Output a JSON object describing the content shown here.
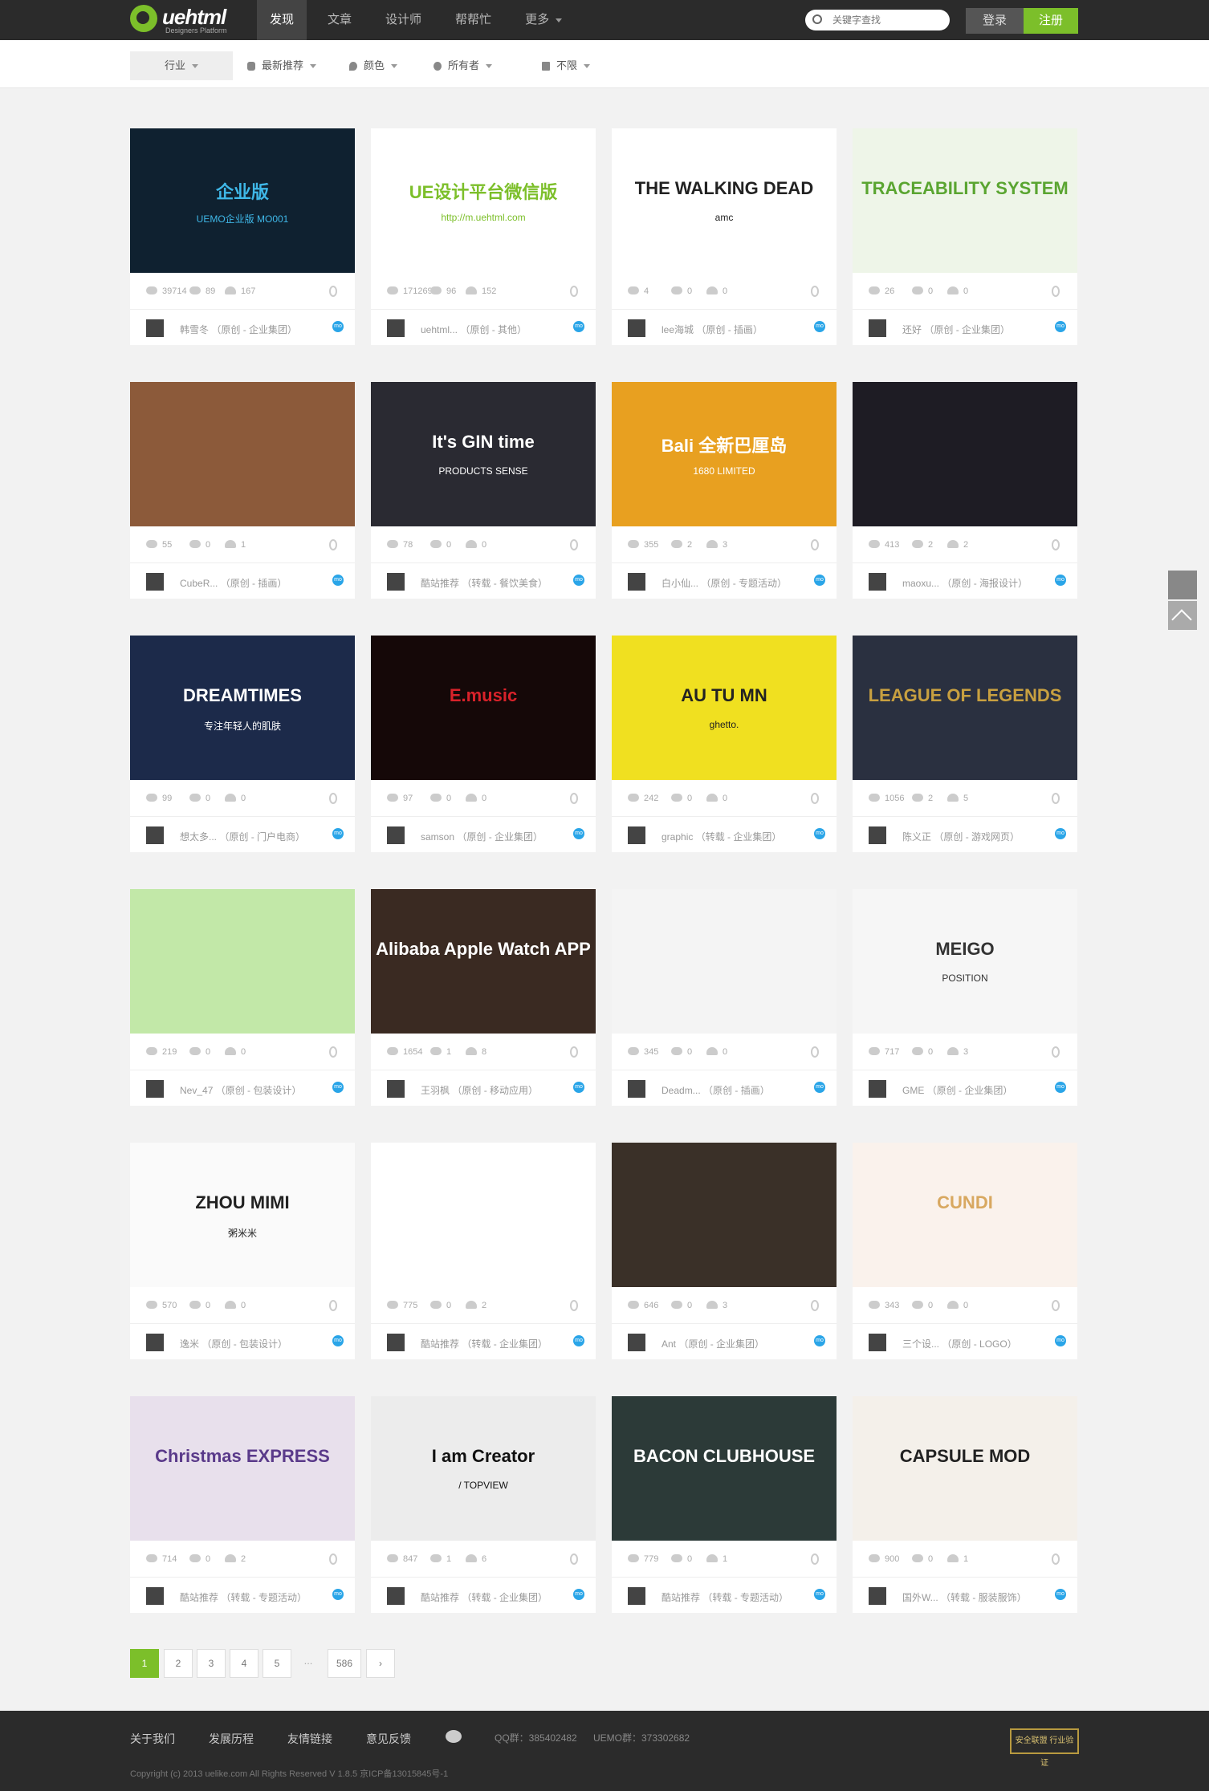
{
  "header": {
    "logo_text": "uehtml",
    "logo_sub": "Designers Platform",
    "nav": [
      "发现",
      "文章",
      "设计师",
      "帮帮忙",
      "更多"
    ],
    "search_placeholder": "关键字查找",
    "login": "登录",
    "register": "注册"
  },
  "filters": [
    "行业",
    "最新推荐",
    "颜色",
    "所有者",
    "不限"
  ],
  "cards": [
    {
      "title": "企业版",
      "sub": "UEMO企业版  MO001",
      "bg": "#0f2130",
      "fg": "#3fb8e8",
      "views": "39714",
      "comments": "89",
      "likes": "167",
      "author": "韩雪冬",
      "category": "（原创 - 企业集团）"
    },
    {
      "title": "UE设计平台微信版",
      "sub": "http://m.uehtml.com",
      "bg": "#ffffff",
      "fg": "#7cbf2a",
      "views": "171269",
      "comments": "96",
      "likes": "152",
      "author": "uehtml...",
      "category": "（原创 - 其他）"
    },
    {
      "title": "THE WALKING DEAD",
      "sub": "amc",
      "bg": "#ffffff",
      "fg": "#222222",
      "views": "4",
      "comments": "0",
      "likes": "0",
      "author": "lee海城",
      "category": "（原创 - 插画）"
    },
    {
      "title": "TRACEABILITY SYSTEM",
      "sub": "",
      "bg": "#eef5e8",
      "fg": "#5aa531",
      "views": "26",
      "comments": "0",
      "likes": "0",
      "author": "还好",
      "category": "（原创 - 企业集团）"
    },
    {
      "title": "",
      "sub": "",
      "bg": "#8c5a3a",
      "fg": "#ffffff",
      "views": "55",
      "comments": "0",
      "likes": "1",
      "author": "CubeR...",
      "category": "（原创 - 插画）"
    },
    {
      "title": "It's GIN time",
      "sub": "PRODUCTS  SENSE",
      "bg": "#2a2a32",
      "fg": "#ffffff",
      "views": "78",
      "comments": "0",
      "likes": "0",
      "author": "酷站推荐",
      "category": "（转载 - 餐饮美食）"
    },
    {
      "title": "Bali 全新巴厘岛",
      "sub": "1680 LIMITED",
      "bg": "#e8a020",
      "fg": "#ffffff",
      "views": "355",
      "comments": "2",
      "likes": "3",
      "author": "白小仙...",
      "category": "（原创 - 专题活动）"
    },
    {
      "title": "",
      "sub": "",
      "bg": "#1e1c24",
      "fg": "#ffffff",
      "views": "413",
      "comments": "2",
      "likes": "2",
      "author": "maoxu...",
      "category": "（原创 - 海报设计）"
    },
    {
      "title": "DREAMTIMES",
      "sub": "专注年轻人的肌肤",
      "bg": "#1c2a4a",
      "fg": "#ffffff",
      "views": "99",
      "comments": "0",
      "likes": "0",
      "author": "想太多...",
      "category": "（原创 - 门户电商）"
    },
    {
      "title": "E.music",
      "sub": "",
      "bg": "#150808",
      "fg": "#d8222a",
      "views": "97",
      "comments": "0",
      "likes": "0",
      "author": "samson",
      "category": "（原创 - 企业集团）"
    },
    {
      "title": "AU TU MN",
      "sub": "ghetto.",
      "bg": "#f0e020",
      "fg": "#222222",
      "views": "242",
      "comments": "0",
      "likes": "0",
      "author": "graphic",
      "category": "（转载 - 企业集团）"
    },
    {
      "title": "LEAGUE OF LEGENDS",
      "sub": "",
      "bg": "#2a3040",
      "fg": "#c8a040",
      "views": "1056",
      "comments": "2",
      "likes": "5",
      "author": "陈义正",
      "category": "（原创 - 游戏网页）"
    },
    {
      "title": "",
      "sub": "",
      "bg": "#c2e8a8",
      "fg": "#6a4a90",
      "views": "219",
      "comments": "0",
      "likes": "0",
      "author": "Nev_47",
      "category": "（原创 - 包装设计）"
    },
    {
      "title": "Alibaba Apple Watch APP",
      "sub": "",
      "bg": "#3a2a22",
      "fg": "#ffffff",
      "views": "1654",
      "comments": "1",
      "likes": "8",
      "author": "王羽枫",
      "category": "（原创 - 移动应用）"
    },
    {
      "title": "",
      "sub": "",
      "bg": "#f4f4f4",
      "fg": "#222222",
      "views": "345",
      "comments": "0",
      "likes": "0",
      "author": "Deadm...",
      "category": "（原创 - 插画）"
    },
    {
      "title": "MEIGO",
      "sub": "POSITION",
      "bg": "#f6f6f6",
      "fg": "#333333",
      "views": "717",
      "comments": "0",
      "likes": "3",
      "author": "GME",
      "category": "（原创 - 企业集团）"
    },
    {
      "title": "ZHOU MIMI",
      "sub": "粥米米",
      "bg": "#fafafa",
      "fg": "#222222",
      "views": "570",
      "comments": "0",
      "likes": "0",
      "author": "逸米",
      "category": "（原创 - 包装设计）"
    },
    {
      "title": "",
      "sub": "",
      "bg": "#ffffff",
      "fg": "#2a3aa8",
      "views": "775",
      "comments": "0",
      "likes": "2",
      "author": "酷站推荐",
      "category": "（转载 - 企业集团）"
    },
    {
      "title": "",
      "sub": "",
      "bg": "#3a3028",
      "fg": "#ffffff",
      "views": "646",
      "comments": "0",
      "likes": "3",
      "author": "Ant",
      "category": "（原创 - 企业集团）"
    },
    {
      "title": "CUNDI",
      "sub": "",
      "bg": "#faf2ec",
      "fg": "#d8a860",
      "views": "343",
      "comments": "0",
      "likes": "0",
      "author": "三个设...",
      "category": "（原创 - LOGO）"
    },
    {
      "title": "Christmas EXPRESS",
      "sub": "",
      "bg": "#e8e0ec",
      "fg": "#5a3a8a",
      "views": "714",
      "comments": "0",
      "likes": "2",
      "author": "酷站推荐",
      "category": "（转载 - 专题活动）"
    },
    {
      "title": "I am Creator",
      "sub": "/ TOPVIEW",
      "bg": "#ececec",
      "fg": "#111111",
      "views": "847",
      "comments": "1",
      "likes": "6",
      "author": "酷站推荐",
      "category": "（转载 - 企业集团）"
    },
    {
      "title": "BACON CLUBHOUSE",
      "sub": "",
      "bg": "#2c3a38",
      "fg": "#ffffff",
      "views": "779",
      "comments": "0",
      "likes": "1",
      "author": "酷站推荐",
      "category": "（转载 - 专题活动）"
    },
    {
      "title": "CAPSULE MOD",
      "sub": "",
      "bg": "#f4f0ea",
      "fg": "#222222",
      "views": "900",
      "comments": "0",
      "likes": "1",
      "author": "国外W...",
      "category": "（转载 - 服装服饰）"
    }
  ],
  "pagination": [
    "1",
    "2",
    "3",
    "4",
    "5",
    "...",
    "586"
  ],
  "footer": {
    "links": [
      "关于我们",
      "发展历程",
      "友情链接",
      "意见反馈"
    ],
    "qq": "QQ群：385402482",
    "uemo": "UEMO群：373302682",
    "copyright": "Copyright (c) 2013 uelike.com All Rights Reserved V 1.8.5 京ICP备13015845号-1",
    "trust": "安全联盟 行业验证"
  },
  "colors": {
    "accent": "#7cbf2a",
    "topbar": "#2b2b2b",
    "mo_badge": "#2aa5e8"
  }
}
